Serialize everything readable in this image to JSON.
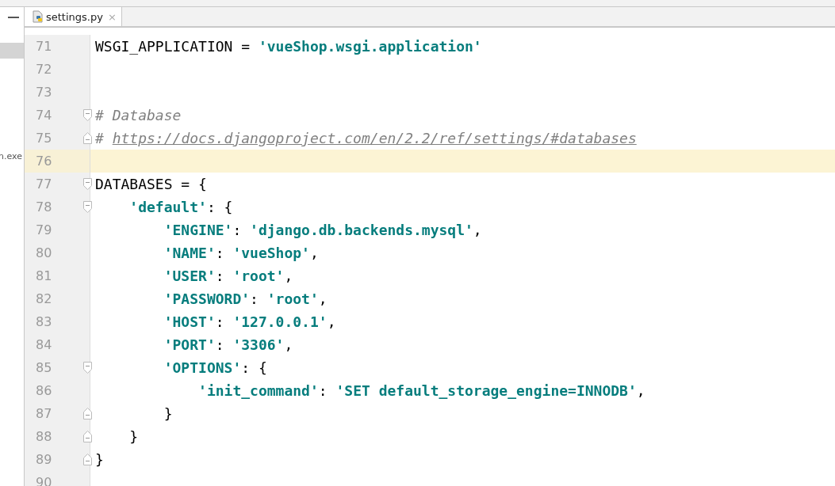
{
  "side_panel": {
    "items": [
      {
        "selected": true
      },
      {
        "label": "n.exe",
        "selected": false
      }
    ]
  },
  "tabs": [
    {
      "label": "settings.py",
      "selected": true,
      "close": "×"
    }
  ],
  "editor": {
    "lines": [
      {
        "number": "71",
        "current": false,
        "tokens": [
          {
            "kind": "plain",
            "text": "WSGI_APPLICATION = "
          },
          {
            "kind": "string",
            "text": "'vueShop.wsgi.application'"
          }
        ]
      },
      {
        "number": "72",
        "current": false
      },
      {
        "number": "73",
        "current": false
      },
      {
        "number": "74",
        "fold_start": true,
        "current": false,
        "tokens": [
          {
            "kind": "comment",
            "text": "# Database"
          }
        ]
      },
      {
        "number": "75",
        "fold_end": true,
        "current": false,
        "tokens": [
          {
            "kind": "comment",
            "text": "# "
          },
          {
            "kind": "link",
            "text": "https://docs.djangoproject.com/en/2.2/ref/settings/#databases"
          }
        ]
      },
      {
        "number": "76",
        "current": true
      },
      {
        "number": "77",
        "fold_start": true,
        "current": false,
        "tokens": [
          {
            "kind": "plain",
            "text": "DATABASES = {"
          }
        ]
      },
      {
        "number": "78",
        "fold_start": true,
        "current": false,
        "tokens": [
          {
            "kind": "string",
            "text": "    'default'"
          },
          {
            "kind": "plain",
            "text": ": {"
          }
        ]
      },
      {
        "number": "79",
        "current": false,
        "tokens": [
          {
            "kind": "string",
            "text": "        'ENGINE'"
          },
          {
            "kind": "plain",
            "text": ": "
          },
          {
            "kind": "string",
            "text": "'django.db.backends.mysql'"
          },
          {
            "kind": "plain",
            "text": ","
          }
        ]
      },
      {
        "number": "80",
        "current": false,
        "tokens": [
          {
            "kind": "string",
            "text": "        'NAME'"
          },
          {
            "kind": "plain",
            "text": ": "
          },
          {
            "kind": "string",
            "text": "'vueShop'"
          },
          {
            "kind": "plain",
            "text": ","
          }
        ]
      },
      {
        "number": "81",
        "current": false,
        "tokens": [
          {
            "kind": "string",
            "text": "        'USER'"
          },
          {
            "kind": "plain",
            "text": ": "
          },
          {
            "kind": "string",
            "text": "'root'"
          },
          {
            "kind": "plain",
            "text": ","
          }
        ]
      },
      {
        "number": "82",
        "current": false,
        "tokens": [
          {
            "kind": "string",
            "text": "        'PASSWORD'"
          },
          {
            "kind": "plain",
            "text": ": "
          },
          {
            "kind": "string",
            "text": "'root'"
          },
          {
            "kind": "plain",
            "text": ","
          }
        ]
      },
      {
        "number": "83",
        "current": false,
        "tokens": [
          {
            "kind": "string",
            "text": "        'HOST'"
          },
          {
            "kind": "plain",
            "text": ": "
          },
          {
            "kind": "string",
            "text": "'127.0.0.1'"
          },
          {
            "kind": "plain",
            "text": ","
          }
        ]
      },
      {
        "number": "84",
        "current": false,
        "tokens": [
          {
            "kind": "string",
            "text": "        'PORT'"
          },
          {
            "kind": "plain",
            "text": ": "
          },
          {
            "kind": "string",
            "text": "'3306'"
          },
          {
            "kind": "plain",
            "text": ","
          }
        ]
      },
      {
        "number": "85",
        "fold_start": true,
        "current": false,
        "tokens": [
          {
            "kind": "string",
            "text": "        'OPTIONS'"
          },
          {
            "kind": "plain",
            "text": ": {"
          }
        ]
      },
      {
        "number": "86",
        "current": false,
        "tokens": [
          {
            "kind": "string",
            "text": "            'init_command'"
          },
          {
            "kind": "plain",
            "text": ": "
          },
          {
            "kind": "string",
            "text": "'SET default_storage_engine=INNODB'"
          },
          {
            "kind": "plain",
            "text": ","
          }
        ]
      },
      {
        "number": "87",
        "fold_end": true,
        "current": false,
        "tokens": [
          {
            "kind": "plain",
            "text": "        }"
          }
        ]
      },
      {
        "number": "88",
        "fold_end": true,
        "current": false,
        "tokens": [
          {
            "kind": "plain",
            "text": "    }"
          }
        ]
      },
      {
        "number": "89",
        "fold_end": true,
        "current": false,
        "tokens": [
          {
            "kind": "plain",
            "text": "}"
          }
        ]
      },
      {
        "number": "90",
        "current": false
      }
    ]
  }
}
